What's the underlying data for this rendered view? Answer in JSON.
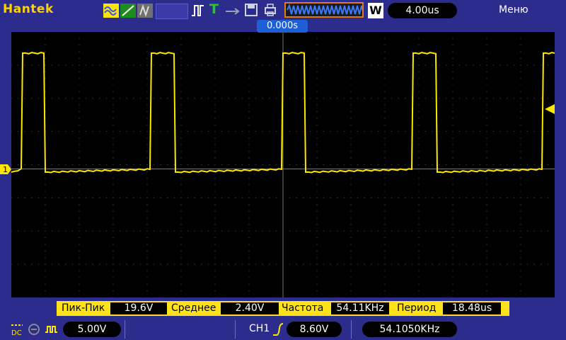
{
  "header": {
    "brand": "Hantek",
    "timebase": "4.00us",
    "acq_mode_badge": "W",
    "menu_label": "Меню"
  },
  "screen": {
    "trigger_position_label": "0.000s",
    "channel_marker_label": "1"
  },
  "measurements": [
    {
      "label": "Пик-Пик",
      "value": "19.6V"
    },
    {
      "label": "Среднее",
      "value": "2.40V"
    },
    {
      "label": "Частота",
      "value": "54.11KHz"
    },
    {
      "label": "Период",
      "value": "18.48us"
    }
  ],
  "footer": {
    "coupling": "DC",
    "ch1_volts_div": "5.00V",
    "trigger_channel": "CH1",
    "trigger_level": "8.60V",
    "frequency_counter": "54.1050KHz"
  },
  "colors": {
    "trace": "#ffe600",
    "background": "#2c2c8c",
    "grid": "#5a5a5a",
    "accent_trigger": "#1e5fd6",
    "buffer_border": "#e07a1e"
  }
}
